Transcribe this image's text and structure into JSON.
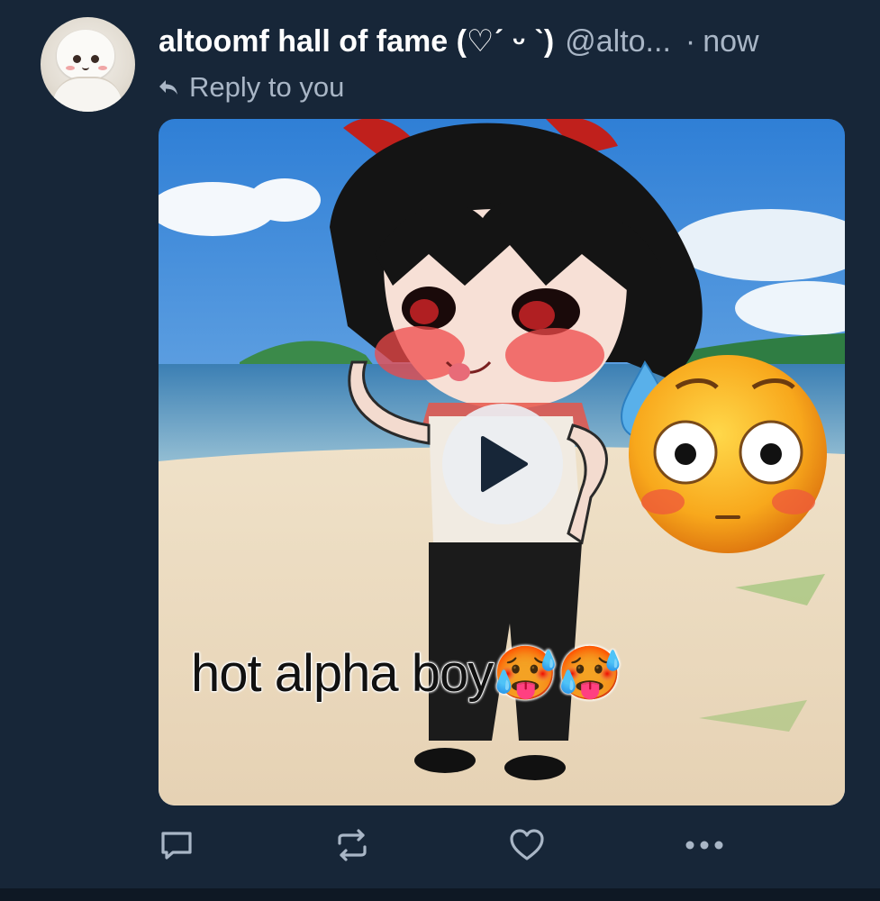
{
  "post": {
    "author_name": "altoomf hall of fame (♡ˊ ᵕ ˋ)",
    "author_handle": "@alto...",
    "separator": "·",
    "timestamp": "now",
    "reply_label": "Reply to you",
    "media": {
      "type": "video",
      "caption": "hot alpha boy🥵🥵"
    }
  },
  "actions": {
    "reply_icon": "speech-bubble-icon",
    "repost_icon": "repost-arrows-icon",
    "like_icon": "heart-icon",
    "more_icon": "ellipsis-icon"
  },
  "colors": {
    "background": "#172638",
    "muted_text": "#a9b6c6",
    "primary_text": "#ffffff"
  }
}
